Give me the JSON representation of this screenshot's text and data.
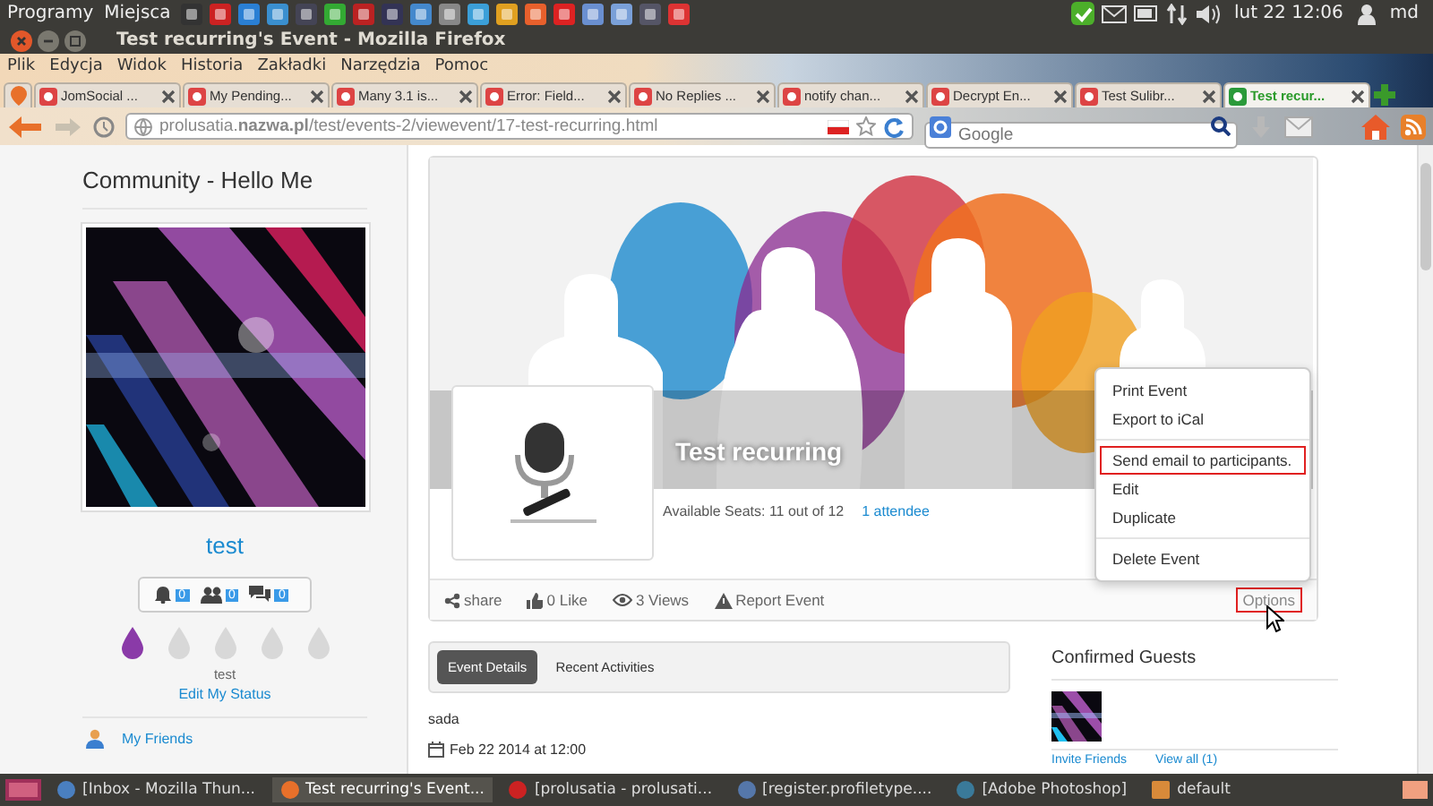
{
  "system_panel": {
    "menus": [
      "Programy",
      "Miejsca"
    ],
    "clock": "lut 22 12:06",
    "user": "md"
  },
  "window": {
    "title": "Test recurring's Event - Mozilla Firefox"
  },
  "menu_bar": [
    "Plik",
    "Edycja",
    "Widok",
    "Historia",
    "Zakładki",
    "Narzędzia",
    "Pomoc"
  ],
  "browser_tabs": [
    {
      "label": "JomSocial ...",
      "selected": false
    },
    {
      "label": "My Pending...",
      "selected": false
    },
    {
      "label": "Many 3.1 is...",
      "selected": false
    },
    {
      "label": "Error: Field...",
      "selected": false
    },
    {
      "label": "No Replies ...",
      "selected": false
    },
    {
      "label": "notify chan...",
      "selected": false
    },
    {
      "label": "Decrypt En...",
      "selected": false
    },
    {
      "label": "Test Sulibr...",
      "selected": false
    },
    {
      "label": "Test recur...",
      "selected": true
    }
  ],
  "address_bar": {
    "url": "prolusatia.**nazwa.pl**/test/events-2/viewevent/17-test-recurring.html"
  },
  "search_bar": {
    "placeholder": "Google"
  },
  "sidebar": {
    "title": "Community - Hello Me",
    "username": "test",
    "counters": [
      {
        "kind": "notifications",
        "count": "0"
      },
      {
        "kind": "friends",
        "count": "0"
      },
      {
        "kind": "messages",
        "count": "0"
      }
    ],
    "rating": {
      "stars": 1
    },
    "status": "test",
    "edit_status": "Edit My Status",
    "links": [
      "My Friends"
    ]
  },
  "event": {
    "title": "Test recurring",
    "seats": "Available Seats: 11 out of 12",
    "attendees": "1 attendee",
    "actions": [
      {
        "kind": "share",
        "label": "share"
      },
      {
        "kind": "like",
        "label": "0 Like"
      },
      {
        "kind": "views",
        "label": "3 Views"
      },
      {
        "kind": "report",
        "label": "Report Event"
      }
    ],
    "options": {
      "label": "Options",
      "highlighted": true
    },
    "options_menu": [
      [
        {
          "label": "Print Event",
          "highlighted": false
        },
        {
          "label": "Export to iCal",
          "highlighted": false
        }
      ],
      [
        {
          "label": "Send email to participants.",
          "highlighted": true
        },
        {
          "label": "Edit",
          "highlighted": false
        },
        {
          "label": "Duplicate",
          "highlighted": false
        }
      ],
      [
        {
          "label": "Delete Event",
          "highlighted": false
        }
      ]
    ]
  },
  "details_tabs": [
    {
      "label": "Event Details",
      "selected": true
    },
    {
      "label": "Recent Activities",
      "selected": false
    }
  ],
  "description": "sada",
  "date": "Feb 22 2014 at 12:00",
  "guests": {
    "title": "Confirmed Guests",
    "links": [
      "Invite Friends",
      "View all (1)"
    ]
  },
  "taskbar": [
    {
      "kind": "mail",
      "label": "[Inbox - Mozilla Thun...",
      "selected": false
    },
    {
      "kind": "browser",
      "label": "Test recurring's Event...",
      "selected": true
    },
    {
      "kind": "ftp",
      "label": "[prolusatia - prolusati...",
      "selected": false
    },
    {
      "kind": "chrome",
      "label": "[register.profiletype....",
      "selected": false
    },
    {
      "kind": "editor",
      "label": "[Adobe Photoshop]",
      "selected": false
    },
    {
      "kind": "folder",
      "label": "default",
      "selected": false
    }
  ]
}
